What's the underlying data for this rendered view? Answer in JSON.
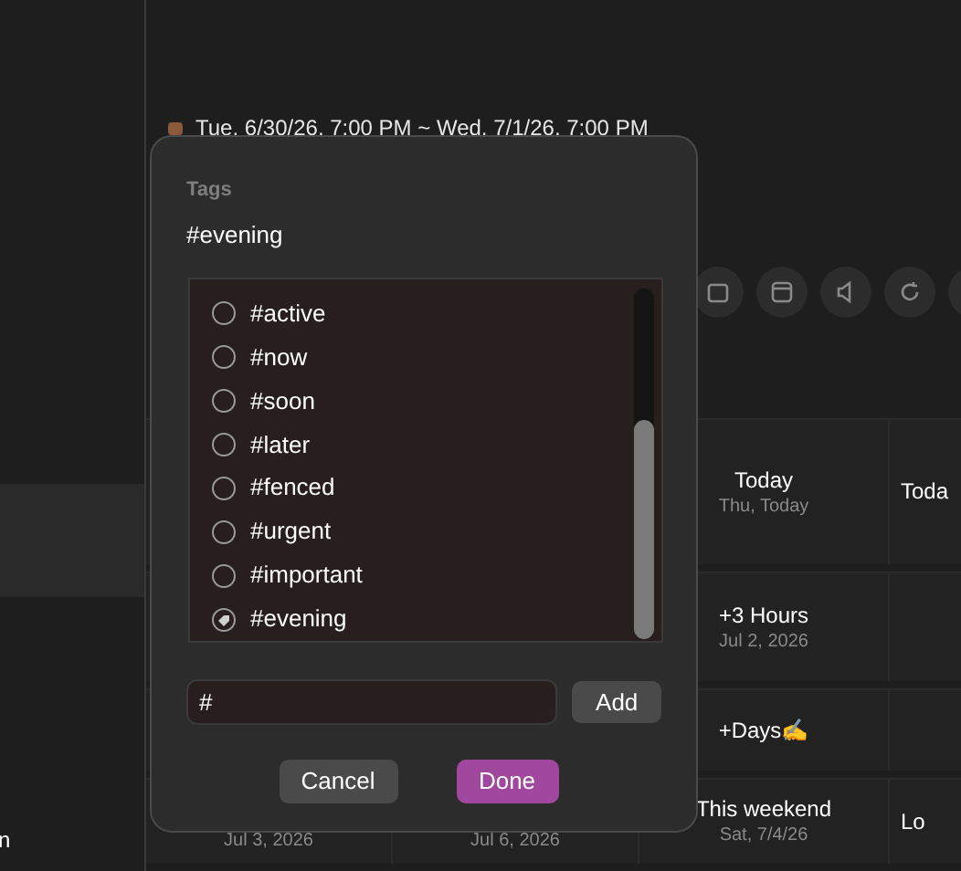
{
  "event": {
    "date_range": "Tue, 6/30/26, 7:00 PM ~ Wed, 7/1/26, 7:00 PM"
  },
  "sidebar": {
    "items": [
      {
        "label": "n"
      }
    ]
  },
  "grid": {
    "rows": [
      [
        {},
        {},
        {
          "title": "Today",
          "subtitle": "Thu, Today"
        },
        {
          "title": "Toda"
        }
      ],
      [
        {},
        {},
        {
          "title": "+3 Hours",
          "subtitle": "Jul 2, 2026"
        },
        {}
      ],
      [
        {},
        {},
        {
          "title": "+Days✍️"
        },
        {}
      ],
      [
        {
          "subtitle": "Jul 3, 2026"
        },
        {
          "subtitle": "Jul 6, 2026"
        },
        {
          "title": "This weekend",
          "subtitle": "Sat, 7/4/26"
        },
        {
          "title": "Lo"
        }
      ]
    ]
  },
  "dialog": {
    "label": "Tags",
    "value": "#evening",
    "tags": [
      {
        "label": "#active",
        "selected": false
      },
      {
        "label": "#now",
        "selected": false
      },
      {
        "label": "#soon",
        "selected": false
      },
      {
        "label": "#later",
        "selected": false
      },
      {
        "label": "#fenced",
        "selected": false
      },
      {
        "label": "#urgent",
        "selected": false
      },
      {
        "label": "#important",
        "selected": false
      },
      {
        "label": "#evening",
        "selected": true
      }
    ],
    "new_tag": {
      "value": "#"
    },
    "add_button": "Add",
    "cancel_button": "Cancel",
    "done_button": "Done"
  }
}
